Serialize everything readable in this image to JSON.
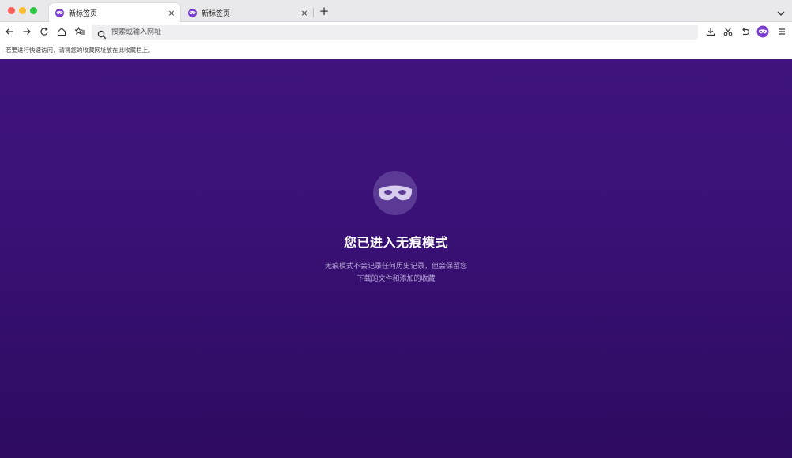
{
  "tabs": [
    {
      "title": "新标签页",
      "close": "×",
      "active": true
    },
    {
      "title": "新标签页",
      "close": "×",
      "active": false
    }
  ],
  "new_tab_label": "+",
  "toolbar": {
    "url_placeholder": "搜索或输入网址",
    "icons": [
      "back-icon",
      "forward-icon",
      "reload-icon",
      "home-icon",
      "bookmark-star-icon",
      "search-icon",
      "download-icon",
      "screenshot-icon",
      "undo-icon",
      "private-mask-icon",
      "menu-icon"
    ]
  },
  "bookmarks_bar": {
    "hint": "若要进行快速访问，请将您的收藏网址放在此收藏栏上。"
  },
  "private": {
    "heading": "您已进入无痕模式",
    "desc_line1": "无痕模式不会记录任何历史记录，但会保留您",
    "desc_line2": "下载的文件和添加的收藏"
  },
  "colors": {
    "accent": "#7b3fd2",
    "content_top": "#40137d",
    "content_bottom": "#2d0b5f"
  }
}
